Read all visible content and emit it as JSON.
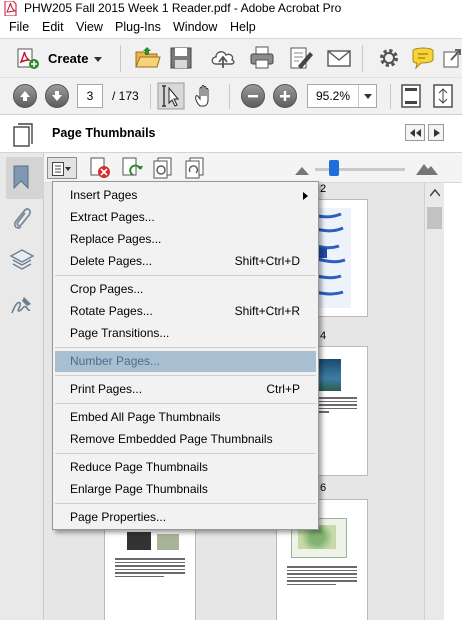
{
  "window": {
    "title": "PHW205 Fall 2015 Week 1 Reader.pdf - Adobe Acrobat Pro"
  },
  "menubar": {
    "items": [
      "File",
      "Edit",
      "View",
      "Plug-Ins",
      "Window",
      "Help"
    ]
  },
  "toolbar": {
    "create_label": "Create",
    "icons": [
      "open-folder-icon",
      "save-icon",
      "upload-cloud-icon",
      "print-icon",
      "edit-pdf-icon",
      "email-icon",
      "gear-icon",
      "comment-icon",
      "share-icon"
    ]
  },
  "navigation": {
    "current_page": "3",
    "page_count": "/ 173",
    "zoom": "95.2%"
  },
  "panel": {
    "title": "Page Thumbnails"
  },
  "thumbnails": {
    "page_numbers": [
      "2",
      "4",
      "6"
    ]
  },
  "context_menu": {
    "items": [
      {
        "label": "Insert Pages",
        "shortcut": "",
        "submenu": true
      },
      {
        "label": "Extract Pages...",
        "shortcut": ""
      },
      {
        "label": "Replace Pages...",
        "shortcut": ""
      },
      {
        "label": "Delete Pages...",
        "shortcut": "Shift+Ctrl+D"
      },
      {
        "label": "Crop Pages...",
        "shortcut": ""
      },
      {
        "label": "Rotate Pages...",
        "shortcut": "Shift+Ctrl+R"
      },
      {
        "label": "Page Transitions...",
        "shortcut": ""
      },
      {
        "label": "Number Pages...",
        "shortcut": "",
        "highlighted": true
      },
      {
        "label": "Print Pages...",
        "shortcut": "Ctrl+P"
      },
      {
        "label": "Embed All Page Thumbnails",
        "shortcut": ""
      },
      {
        "label": "Remove Embedded Page Thumbnails",
        "shortcut": ""
      },
      {
        "label": "Reduce Page Thumbnails",
        "shortcut": ""
      },
      {
        "label": "Enlarge Page Thumbnails",
        "shortcut": ""
      },
      {
        "label": "Page Properties...",
        "shortcut": ""
      }
    ]
  },
  "colors": {
    "highlight": "#a8bfd2",
    "pdf_red": "#c8102e",
    "slider_blue": "#1e6fd9"
  }
}
